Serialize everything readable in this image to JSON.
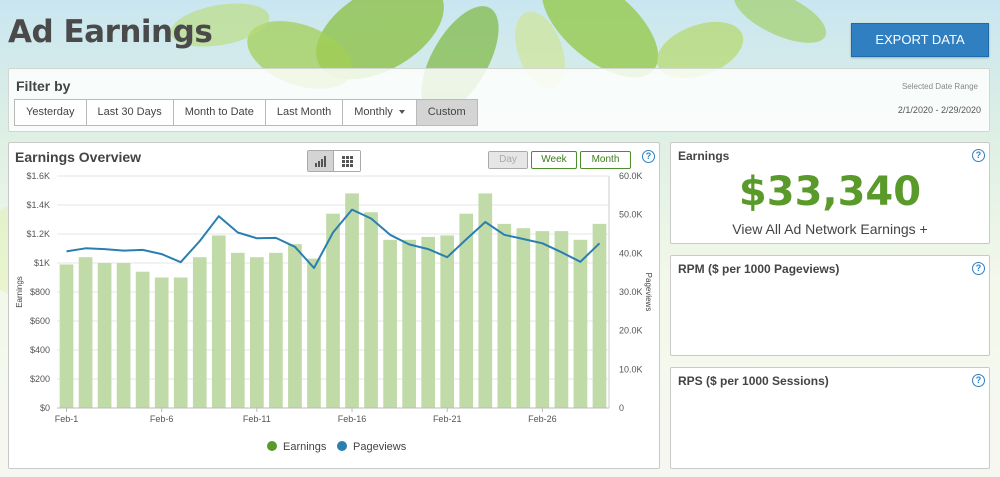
{
  "header": {
    "title": "Ad Earnings",
    "export_label": "EXPORT DATA"
  },
  "filter": {
    "title": "Filter by",
    "buttons": [
      "Yesterday",
      "Last 30 Days",
      "Month to Date",
      "Last Month",
      "Monthly",
      "Custom"
    ],
    "active": "Custom",
    "range_label": "Selected Date Range",
    "range_value": "2/1/2020 - 2/29/2020"
  },
  "overview": {
    "title": "Earnings Overview",
    "periods": [
      "Day",
      "Week",
      "Month"
    ],
    "disabled_period": "Day"
  },
  "cards": {
    "earnings": {
      "title": "Earnings",
      "value": "$33,340",
      "link": "View All Ad Network Earnings +"
    },
    "rpm": {
      "title": "RPM ($ per 1000 Pageviews)"
    },
    "rps": {
      "title": "RPS ($ per 1000 Sessions)"
    }
  },
  "icons": {
    "help": "help-icon",
    "bar_view": "bar-chart-icon",
    "grid_view": "grid-icon"
  },
  "colors": {
    "bar": "#c1dba8",
    "line": "#2a7fb0",
    "earnings_legend": "#5a9a2a",
    "accent": "#2f7fc1"
  },
  "chart_data": {
    "type": "bar",
    "x_ticks": [
      "Feb-1",
      "Feb-6",
      "Feb-11",
      "Feb-16",
      "Feb-21",
      "Feb-26"
    ],
    "y_left_ticks": [
      "$0",
      "$200",
      "$400",
      "$600",
      "$800",
      "$1K",
      "$1.2K",
      "$1.4K",
      "$1.6K"
    ],
    "y_right_ticks": [
      "0",
      "10.0K",
      "20.0K",
      "30.0K",
      "40.0K",
      "50.0K",
      "60.0K"
    ],
    "ylabel": "Earnings",
    "ylabel_right": "Pageviews",
    "ylim": [
      0,
      1600
    ],
    "ylim_right": [
      0,
      60000
    ],
    "legend_position": "bottom",
    "series": [
      {
        "name": "Earnings",
        "type": "bar",
        "values": [
          990,
          1040,
          1000,
          1000,
          940,
          900,
          900,
          1040,
          1190,
          1070,
          1040,
          1070,
          1130,
          1030,
          1340,
          1480,
          1350,
          1160,
          1160,
          1180,
          1190,
          1340,
          1480,
          1270,
          1240,
          1220,
          1220,
          1160,
          1270
        ]
      },
      {
        "name": "Pageviews",
        "type": "line",
        "values": [
          40500,
          41300,
          41100,
          40700,
          40900,
          39800,
          37700,
          43200,
          49600,
          45400,
          43900,
          44000,
          41700,
          36200,
          45400,
          51300,
          49000,
          44800,
          42300,
          41100,
          39000,
          43600,
          48100,
          44800,
          43700,
          42600,
          40300,
          37800,
          42600
        ]
      }
    ]
  }
}
